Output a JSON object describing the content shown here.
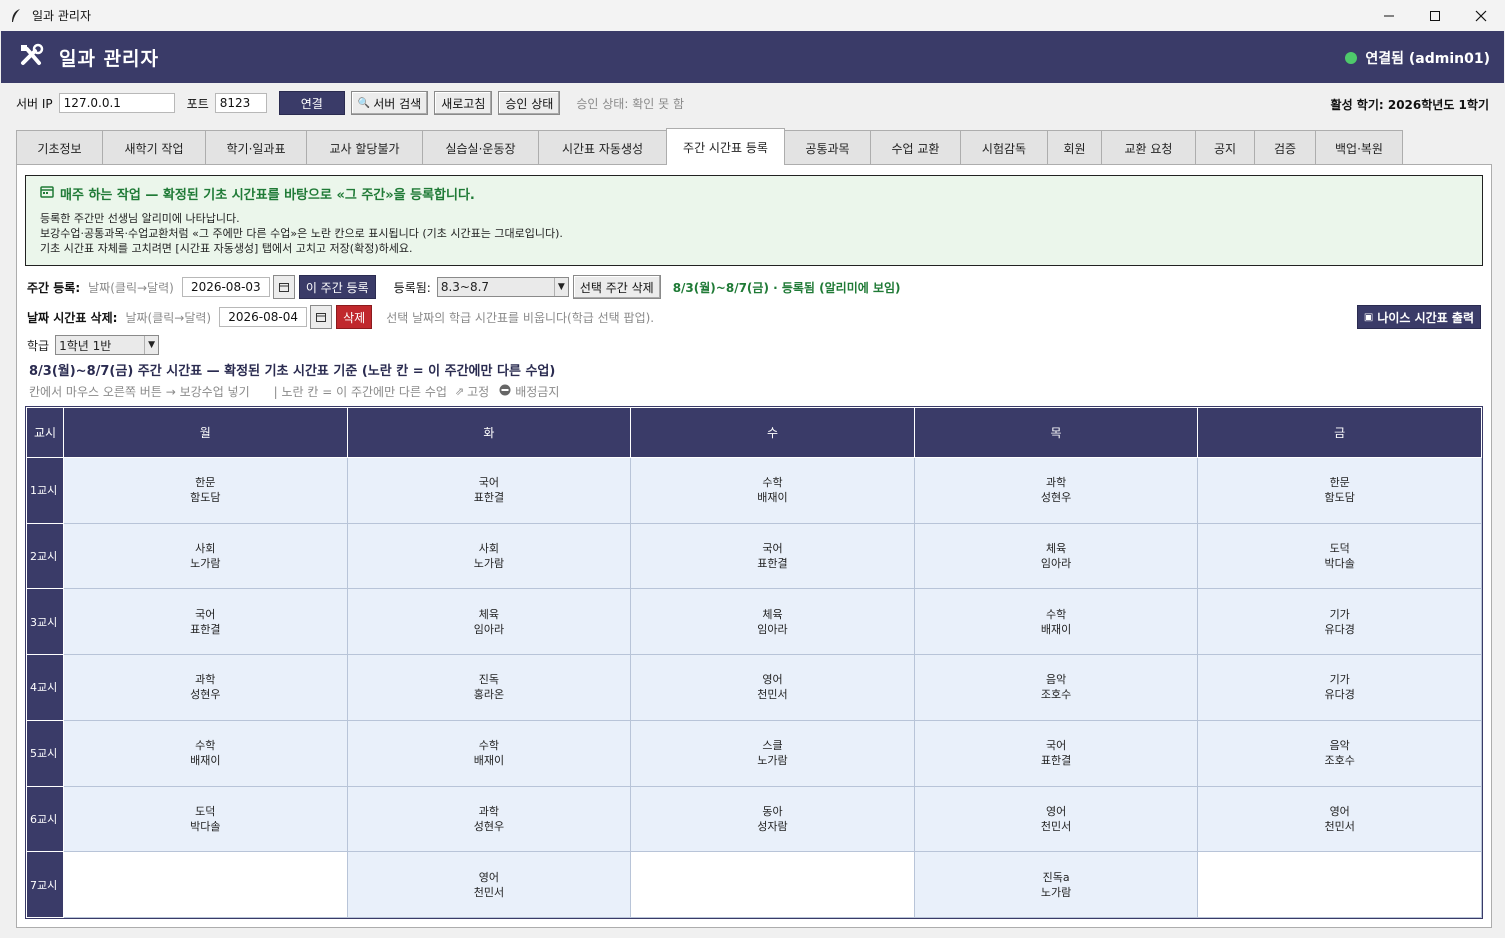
{
  "window": {
    "title": "일과 관리자"
  },
  "header": {
    "title": "일과 관리자",
    "status": "연결됨 (admin01)",
    "status_color": "#4ec96b"
  },
  "server": {
    "ip_label": "서버 IP",
    "ip_value": "127.0.0.1",
    "port_label": "포트",
    "port_value": "8123",
    "connect": "연결",
    "search": "서버 검색",
    "refresh": "새로고침",
    "approval": "승인 상태",
    "approval_status": "승인 상태: 확인 못 함",
    "term": "활성 학기: 2026학년도 1학기"
  },
  "tabs": [
    "기초정보",
    "새학기 작업",
    "학기·일과표",
    "교사 할당불가",
    "실습실·운동장",
    "시간표 자동생성",
    "주간 시간표 등록",
    "공통과목",
    "수업 교환",
    "시험감독",
    "회원",
    "교환 요청",
    "공지",
    "검증",
    "백업·복원"
  ],
  "active_tab": 6,
  "notice": {
    "heading": "매주 하는 작업 — 확정된 기초 시간표를 바탕으로 «그 주간»을 등록합니다.",
    "lines": [
      "등록한 주간만 선생님 알리미에 나타납니다.",
      "보강수업·공통과목·수업교환처럼 «그 주에만 다른 수업»은 노란 칸으로 표시됩니다 (기초 시간표는 그대로입니다).",
      "기초 시간표 자체를 고치려면 [시간표 자동생성] 탭에서 고치고 저장(확정)하세요."
    ]
  },
  "week_reg": {
    "label": "주간 등록:",
    "hint": "날짜(클릭→달력)",
    "date": "2026-08-03",
    "register_btn": "이 주간 등록",
    "registered_label": "등록됨:",
    "registered_value": "8.3~8.7",
    "delete_btn": "선택 주간 삭제",
    "status": "8/3(월)~8/7(금) · 등록됨 (알리미에 보임)"
  },
  "day_del": {
    "label": "날짜 시간표 삭제:",
    "hint": "날짜(클릭→달력)",
    "date": "2026-08-04",
    "delete_btn": "삭제",
    "desc": "선택 날짜의 학급 시간표를 비웁니다(학급 선택 팝업).",
    "neis_btn": "나이스 시간표 출력"
  },
  "class_sel": {
    "label": "학급",
    "value": "1학년 1반"
  },
  "timetable": {
    "title": "8/3(월)~8/7(금) 주간 시간표 — 확정된 기초 시간표 기준  (노란 칸 = 이 주간에만 다른 수업)",
    "legend_1": "칸에서 마우스 오른쪽 버튼 → 보강수업 넣기",
    "legend_2": "|  노란 칸 = 이 주간에만 다른 수업",
    "legend_3": "고정",
    "legend_4": "배정금지",
    "period_header": "교시",
    "days": [
      "월",
      "화",
      "수",
      "목",
      "금"
    ],
    "rows": [
      {
        "period": "1교시",
        "cells": [
          [
            "한문",
            "함도담"
          ],
          [
            "국어",
            "표한결"
          ],
          [
            "수학",
            "배재이"
          ],
          [
            "과학",
            "성현우"
          ],
          [
            "한문",
            "함도담"
          ]
        ]
      },
      {
        "period": "2교시",
        "cells": [
          [
            "사회",
            "노가람"
          ],
          [
            "사회",
            "노가람"
          ],
          [
            "국어",
            "표한결"
          ],
          [
            "체육",
            "임아라"
          ],
          [
            "도덕",
            "박다솔"
          ]
        ]
      },
      {
        "period": "3교시",
        "cells": [
          [
            "국어",
            "표한결"
          ],
          [
            "체육",
            "임아라"
          ],
          [
            "체육",
            "임아라"
          ],
          [
            "수학",
            "배재이"
          ],
          [
            "기가",
            "유다경"
          ]
        ]
      },
      {
        "period": "4교시",
        "cells": [
          [
            "과학",
            "성현우"
          ],
          [
            "진독",
            "홍라온"
          ],
          [
            "영어",
            "천민서"
          ],
          [
            "음악",
            "조호수"
          ],
          [
            "기가",
            "유다경"
          ]
        ]
      },
      {
        "period": "5교시",
        "cells": [
          [
            "수학",
            "배재이"
          ],
          [
            "수학",
            "배재이"
          ],
          [
            "스클",
            "노가람"
          ],
          [
            "국어",
            "표한결"
          ],
          [
            "음악",
            "조호수"
          ]
        ]
      },
      {
        "period": "6교시",
        "cells": [
          [
            "도덕",
            "박다솔"
          ],
          [
            "과학",
            "성현우"
          ],
          [
            "동아",
            "성자람"
          ],
          [
            "영어",
            "천민서"
          ],
          [
            "영어",
            "천민서"
          ]
        ]
      },
      {
        "period": "7교시",
        "cells": [
          [
            "",
            ""
          ],
          [
            "영어",
            "천민서"
          ],
          [
            "",
            ""
          ],
          [
            "진독a",
            "노가람"
          ],
          [
            "",
            ""
          ]
        ]
      }
    ]
  }
}
